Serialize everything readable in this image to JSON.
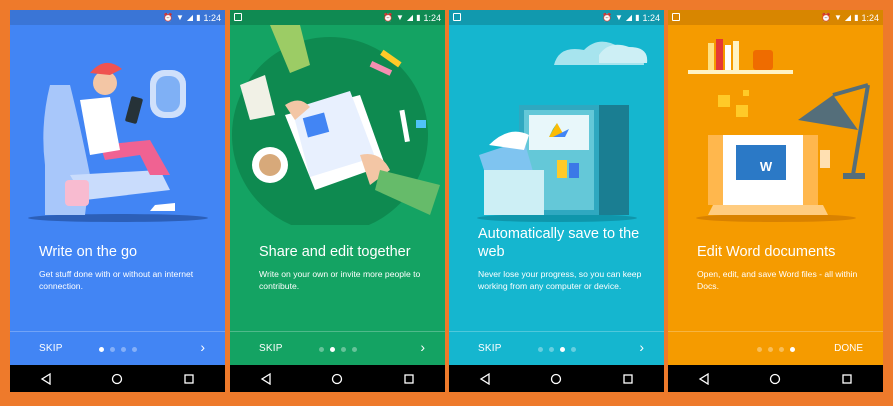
{
  "status": {
    "time": "1:24"
  },
  "screens": [
    {
      "bg": "#4285f4",
      "bar": "#3a75d6",
      "title": "Write on the go",
      "description": "Get stuff done with or without an internet connection.",
      "skip": "SKIP",
      "done": "",
      "active_dot": 0
    },
    {
      "bg": "#14a363",
      "bar": "#0f8a52",
      "title": "Share and edit together",
      "description": "Write on your own or invite more people to contribute.",
      "skip": "SKIP",
      "done": "",
      "active_dot": 1
    },
    {
      "bg": "#15b6cf",
      "bar": "#1199ae",
      "title": "Automatically save to the web",
      "description": "Never lose your progress, so you can keep working from any computer or device.",
      "skip": "SKIP",
      "done": "",
      "active_dot": 2
    },
    {
      "bg": "#f59b00",
      "bar": "#d88600",
      "title": "Edit Word documents",
      "description": "Open, edit, and save Word files - all within Docs.",
      "skip": "",
      "done": "DONE",
      "active_dot": 3
    }
  ],
  "word_badge": "W"
}
